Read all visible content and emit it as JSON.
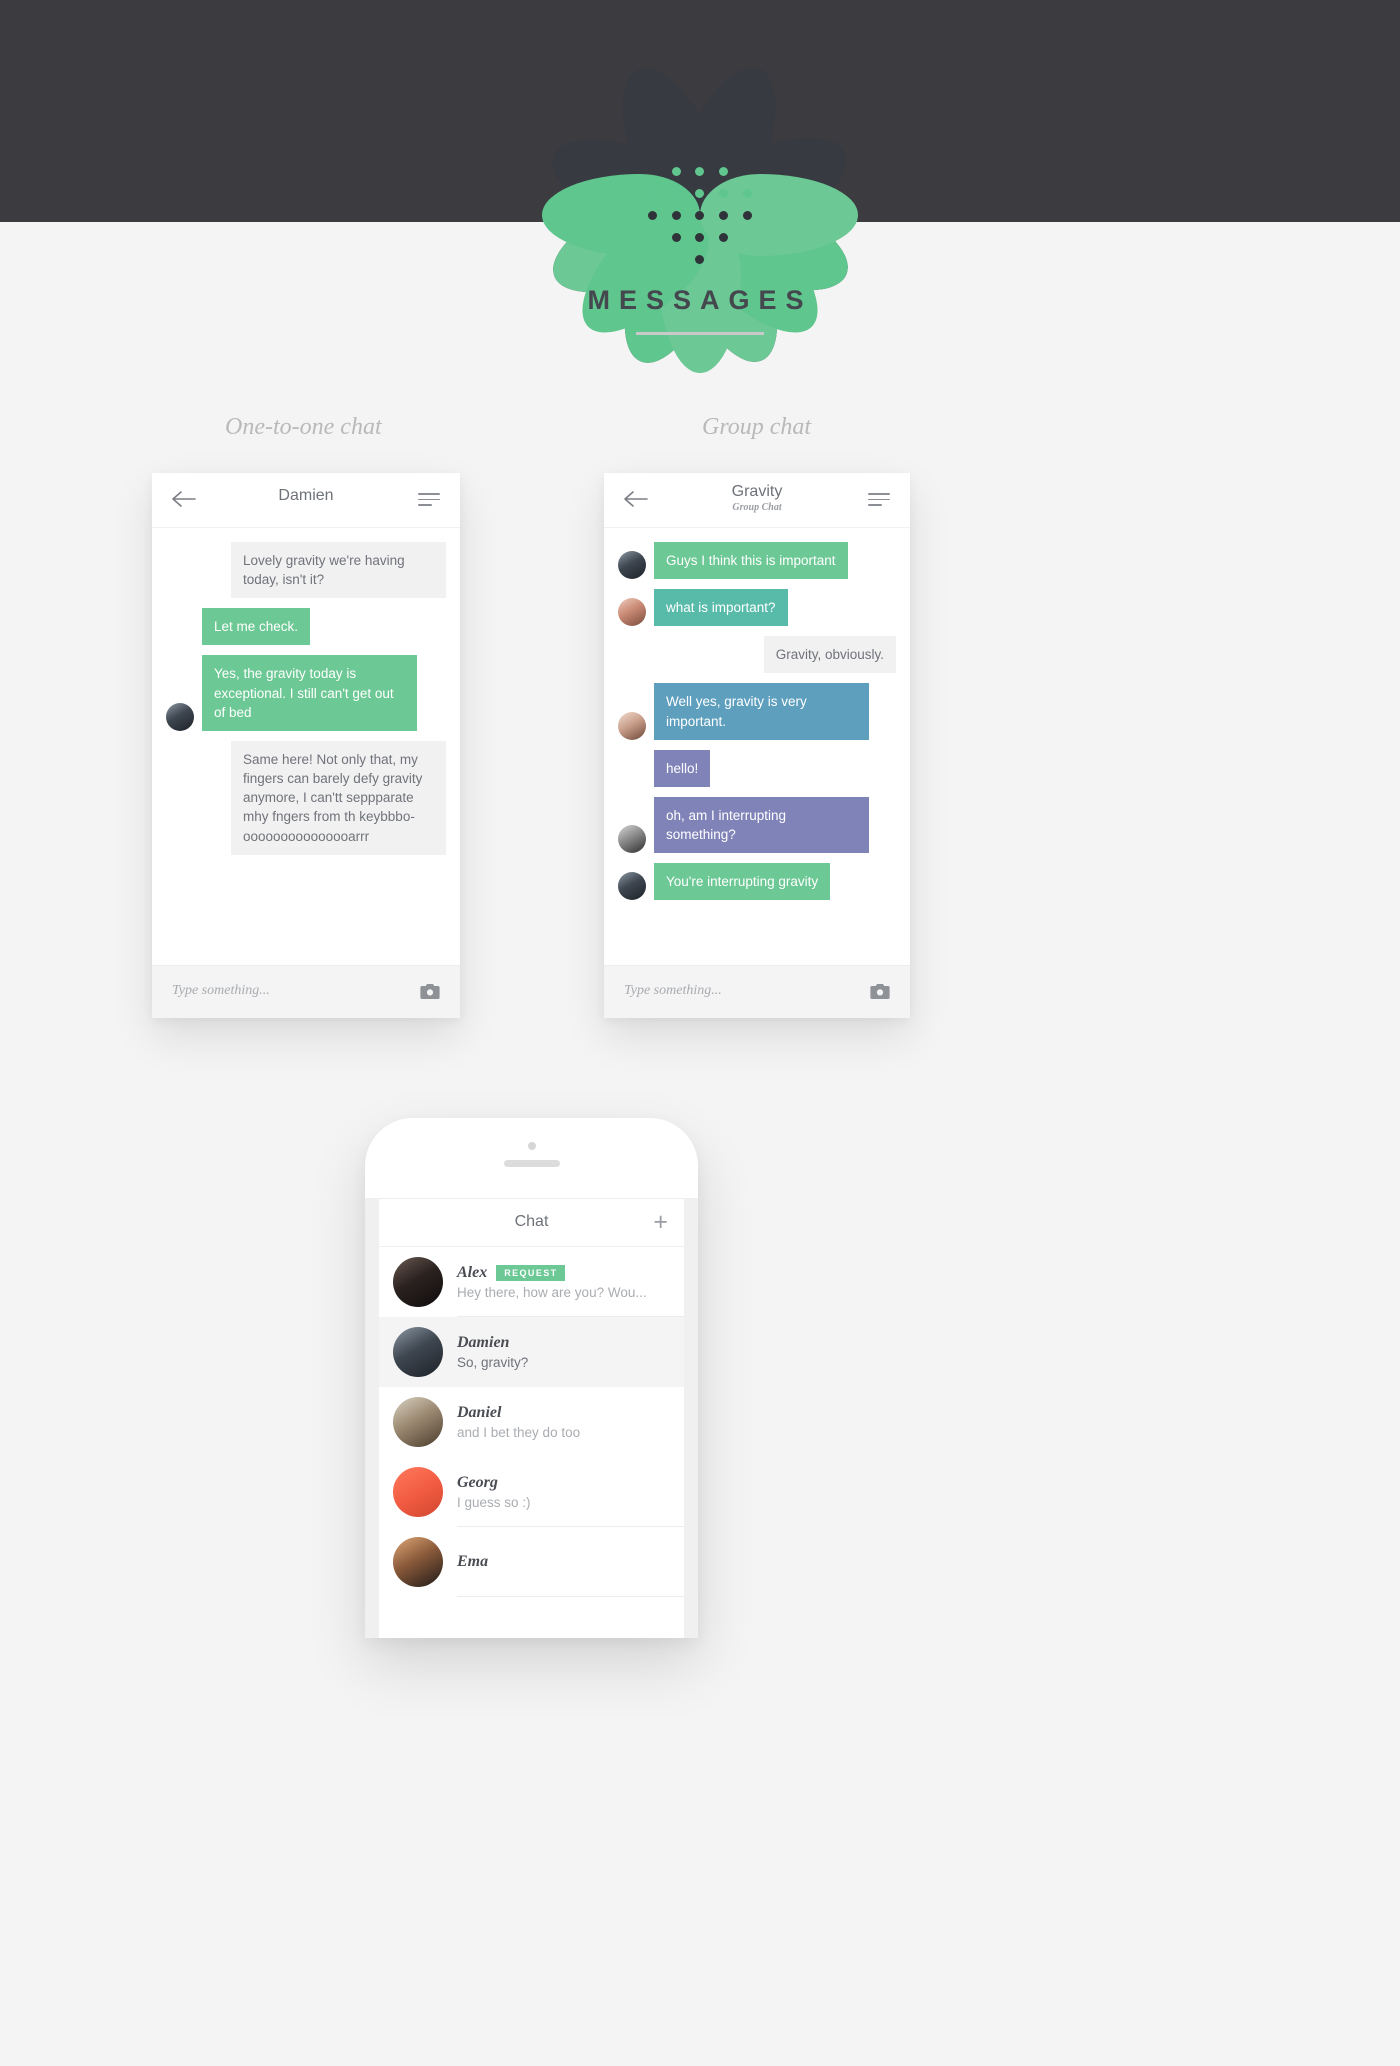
{
  "hero": {
    "brand_title": "MESSAGES",
    "logo_icon": "lotus-flower-logo",
    "bg_color": "#3b3b40",
    "accent_color": "#6cc894"
  },
  "sections": {
    "one_to_one_label": "One-to-one chat",
    "group_label": "Group chat"
  },
  "one_to_one": {
    "header": {
      "title": "Damien",
      "back_icon": "back-arrow-icon",
      "menu_icon": "hamburger-menu-icon"
    },
    "messages": [
      {
        "text": "Lovely gravity we're having today, isn't it?",
        "side": "right",
        "style": "grey",
        "avatar": null
      },
      {
        "text": "Let me check.",
        "side": "left",
        "style": "green",
        "avatar": null
      },
      {
        "text": "Yes, the gravity today is exceptional. I still can't get out of bed",
        "side": "left",
        "style": "green",
        "avatar": "damien"
      },
      {
        "text": "Same here! Not only that, my fingers can barely defy gravity anymore, I can'tt seppparate mhy fngers from th keybbbo-ooooooooooooooarrr",
        "side": "right",
        "style": "grey",
        "avatar": null
      }
    ],
    "input": {
      "placeholder": "Type something...",
      "camera_icon": "camera-icon"
    }
  },
  "group": {
    "header": {
      "title": "Gravity",
      "subtitle": "Group Chat",
      "back_icon": "back-arrow-icon",
      "menu_icon": "hamburger-menu-icon"
    },
    "messages": [
      {
        "text": "Guys I think this is important",
        "side": "left",
        "style": "green",
        "avatar": "damien"
      },
      {
        "text": "what is important?",
        "side": "left",
        "style": "teal",
        "avatar": "woman1"
      },
      {
        "text": "Gravity, obviously.",
        "side": "right",
        "style": "grey",
        "avatar": null
      },
      {
        "text": "Well yes, gravity is very important.",
        "side": "left",
        "style": "blue",
        "avatar": "woman2"
      },
      {
        "text": "hello!",
        "side": "left",
        "style": "purple",
        "avatar": null
      },
      {
        "text": "oh, am I interrupting something?",
        "side": "left",
        "style": "purple",
        "avatar": "bw"
      },
      {
        "text": "You're interrupting gravity",
        "side": "left",
        "style": "green",
        "avatar": "damien"
      }
    ],
    "input": {
      "placeholder": "Type something...",
      "camera_icon": "camera-icon"
    }
  },
  "phone": {
    "topbar": {
      "title": "Chat",
      "add_icon": "plus-icon"
    },
    "chats": [
      {
        "name": "Alex",
        "badge": "REQUEST",
        "preview": "Hey there, how are you? Wou...",
        "avatar": "alex",
        "active": false,
        "preview_dark": false
      },
      {
        "name": "Damien",
        "badge": null,
        "preview": "So, gravity?",
        "avatar": "damien",
        "active": true,
        "preview_dark": true
      },
      {
        "name": "Daniel",
        "badge": null,
        "preview": "and I bet they do too",
        "avatar": "daniel",
        "active": false,
        "preview_dark": false
      },
      {
        "name": "Georg",
        "badge": null,
        "preview": "I guess so :)",
        "avatar": "georg",
        "active": false,
        "preview_dark": false
      },
      {
        "name": "Ema",
        "badge": null,
        "preview": "",
        "avatar": "ema",
        "active": false,
        "preview_dark": false
      }
    ]
  }
}
